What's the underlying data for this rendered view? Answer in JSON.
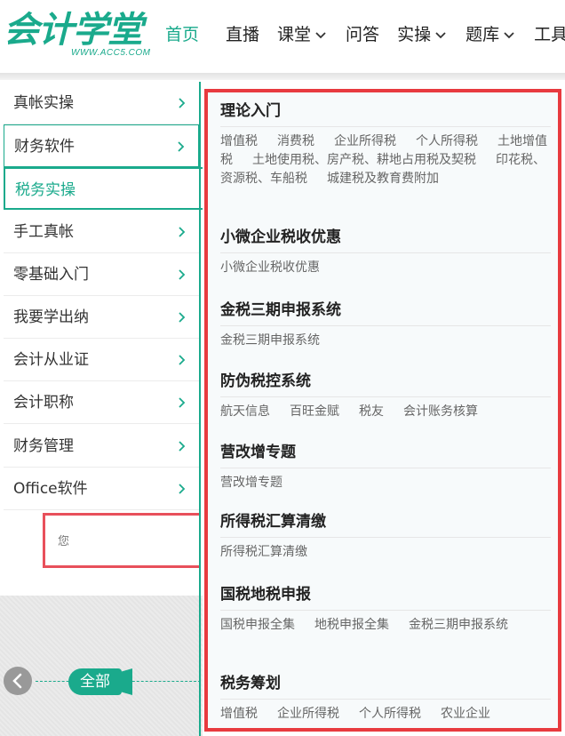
{
  "logo": {
    "main": "会计学堂",
    "sub": "WWW.ACC5.COM"
  },
  "nav": [
    {
      "label": "首页",
      "active": true,
      "dropdown": false
    },
    {
      "label": "直播",
      "active": false,
      "dropdown": false
    },
    {
      "label": "课堂",
      "active": false,
      "dropdown": true
    },
    {
      "label": "问答",
      "active": false,
      "dropdown": false
    },
    {
      "label": "实操",
      "active": false,
      "dropdown": true
    },
    {
      "label": "题库",
      "active": false,
      "dropdown": true
    },
    {
      "label": "工具",
      "active": false,
      "dropdown": true
    }
  ],
  "sidebar": {
    "items": [
      {
        "label": "真帐实操"
      },
      {
        "label": "财务软件"
      },
      {
        "label": "税务实操"
      },
      {
        "label": "手工真帐"
      },
      {
        "label": "零基础入门"
      },
      {
        "label": "我要学出纳"
      },
      {
        "label": "会计从业证"
      },
      {
        "label": "会计职称"
      },
      {
        "label": "财务管理"
      },
      {
        "label": "Office软件"
      }
    ],
    "active_index": 2
  },
  "search": {
    "placeholder": "您"
  },
  "carousel": {
    "all_label": "全部"
  },
  "panel": {
    "categories": [
      {
        "title": "理论入门",
        "links": [
          "增值税",
          "消费税",
          "企业所得税",
          "个人所得税",
          "土地增值税",
          "土地使用税、房产税、耕地占用税及契税",
          "印花税、资源税、车船税",
          "城建税及教育费附加"
        ]
      },
      {
        "title": "小微企业税收优惠",
        "links": [
          "小微企业税收优惠"
        ]
      },
      {
        "title": "金税三期申报系统",
        "links": [
          "金税三期申报系统"
        ]
      },
      {
        "title": "防伪税控系统",
        "links": [
          "航天信息",
          "百旺金赋",
          "税友",
          "会计账务核算"
        ]
      },
      {
        "title": "营改增专题",
        "links": [
          "营改增专题"
        ]
      },
      {
        "title": "所得税汇算清缴",
        "links": [
          "所得税汇算清缴"
        ]
      },
      {
        "title": "国税地税申报",
        "links": [
          "国税申报全集",
          "地税申报全集",
          "金税三期申报系统"
        ]
      },
      {
        "title": "税务筹划",
        "links": [
          "增值税",
          "企业所得税",
          "个人所得税",
          "农业企业"
        ]
      }
    ]
  },
  "colors": {
    "brand": "#1aaa8c",
    "highlight_border": "#e83a3f"
  }
}
